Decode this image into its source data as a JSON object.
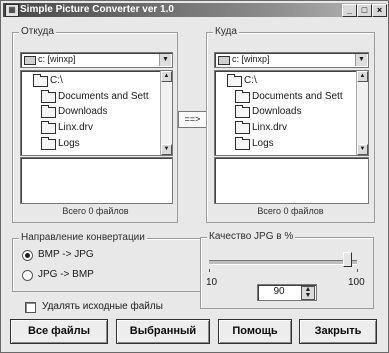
{
  "window": {
    "title": "Simple Picture Converter  ver 1.0",
    "title_icon": "picture-icon",
    "controls": {
      "minimize": "_",
      "maximize": "□",
      "close": "×"
    }
  },
  "source": {
    "group_label": "Откуда",
    "drive": "c: [winxp]",
    "dirs": [
      "C:\\",
      "Documents and Sett",
      "Downloads",
      "Linx.drv",
      "Logs"
    ],
    "count": "Всего 0 файлов"
  },
  "target": {
    "group_label": "Куда",
    "drive": "c: [winxp]",
    "dirs": [
      "C:\\",
      "Documents and Sett",
      "Downloads",
      "Linx.drv",
      "Logs"
    ],
    "count": "Всего 0 файлов"
  },
  "copy_path_button": "==>",
  "direction": {
    "group_label": "Направление конвертации",
    "options": [
      {
        "label": "BMP -> JPG",
        "selected": true
      },
      {
        "label": "JPG -> BMP",
        "selected": false
      }
    ]
  },
  "quality": {
    "group_label": "Качество JPG в %",
    "min_label": "10",
    "max_label": "100",
    "value": "90"
  },
  "delete_source": {
    "label": "Удалять исходные файлы",
    "checked": false
  },
  "buttons": {
    "all_files": "Все файлы",
    "selected": "Выбранный",
    "help": "Помощь",
    "close": "Закрыть"
  }
}
